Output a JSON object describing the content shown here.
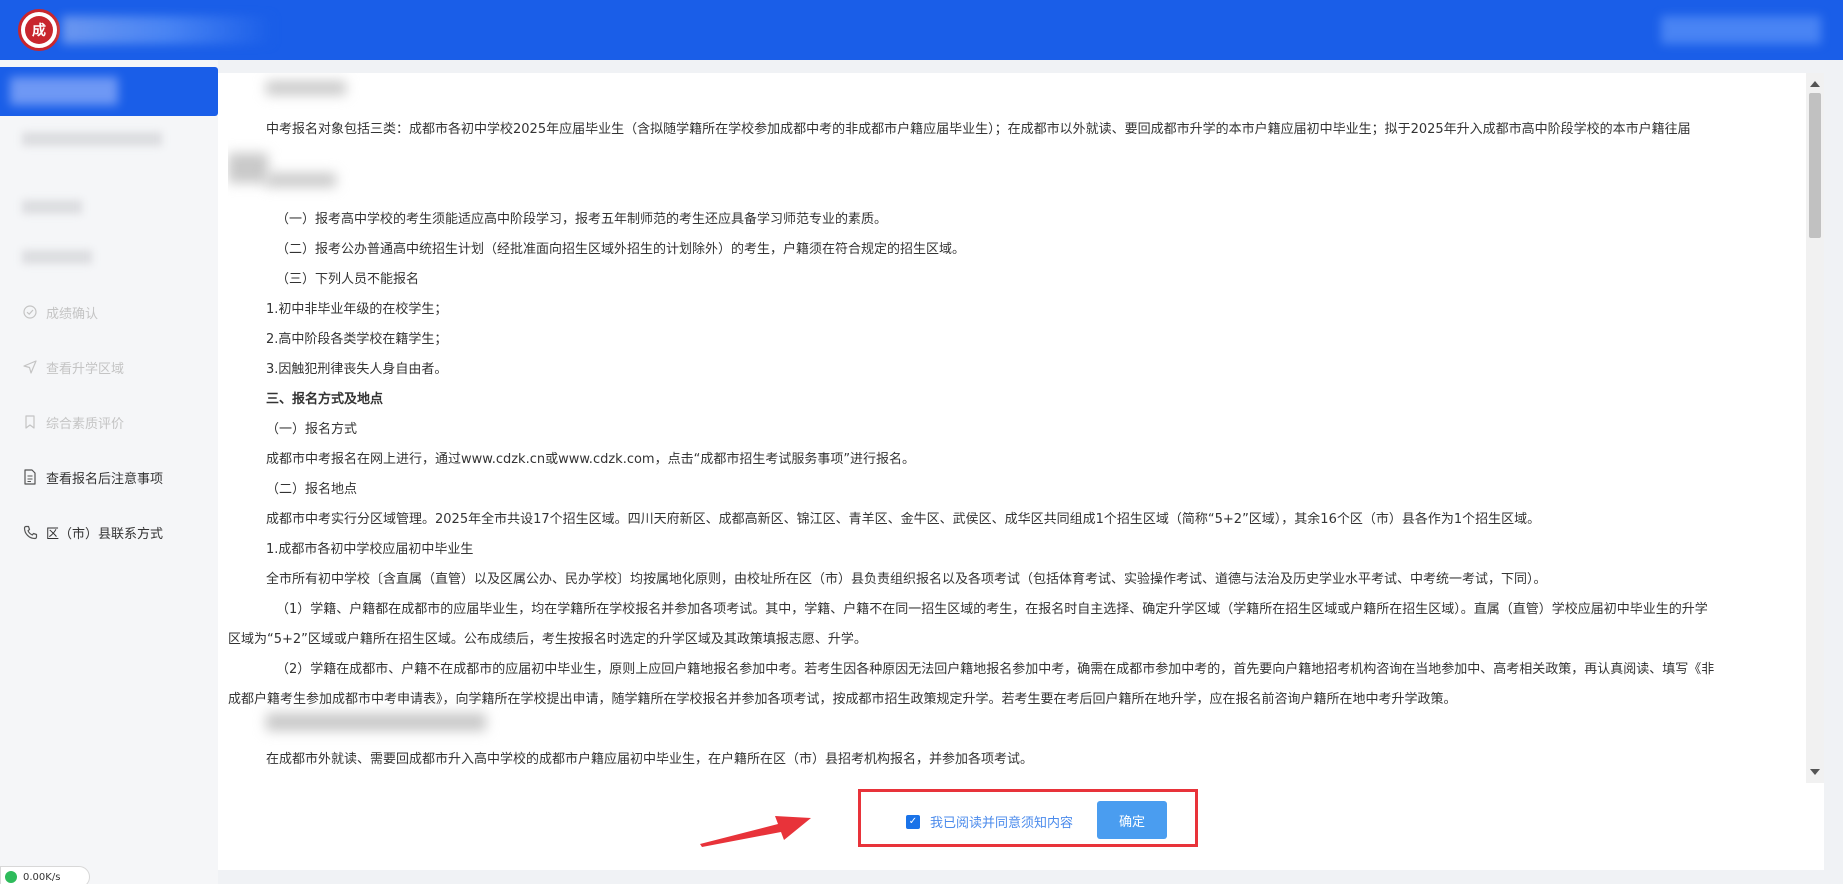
{
  "header": {
    "logo_text": "成"
  },
  "sidebar": {
    "items": [
      {
        "label": "成绩确认",
        "icon": "check-circle-icon",
        "enabled": false
      },
      {
        "label": "查看升学区域",
        "icon": "send-icon",
        "enabled": false
      },
      {
        "label": "综合素质评价",
        "icon": "bookmark-icon",
        "enabled": false
      },
      {
        "label": "查看报名后注意事项",
        "icon": "document-icon",
        "enabled": true
      },
      {
        "label": "区（市）县联系方式",
        "icon": "phone-icon",
        "enabled": true
      }
    ]
  },
  "content": {
    "p0": "中考报名对象包括三类：成都市各初中学校2025年应届毕业生（含拟随学籍所在学校参加成都中考的非成都市户籍应届毕业生）；在成都市以外就读、要回成都市升学的本市户籍应届初中毕业生；拟于2025年升入成都市高中阶段学校的本市户籍往届",
    "p1": "（一）报考高中学校的考生须能适应高中阶段学习，报考五年制师范的考生还应具备学习师范专业的素质。",
    "p2": "（二）报考公办普通高中统招生计划（经批准面向招生区域外招生的计划除外）的考生，户籍须在符合规定的招生区域。",
    "p3": "（三）下列人员不能报名",
    "p4": "1.初中非毕业年级的在校学生；",
    "p5": "2.高中阶段各类学校在籍学生；",
    "p6": "3.因触犯刑律丧失人身自由者。",
    "p7": "三、报名方式及地点",
    "p8": "（一）报名方式",
    "p9": "成都市中考报名在网上进行，通过www.cdzk.cn或www.cdzk.com，点击“成都市招生考试服务事项”进行报名。",
    "p10": "（二）报名地点",
    "p11": "成都市中考实行分区域管理。2025年全市共设17个招生区域。四川天府新区、成都高新区、锦江区、青羊区、金牛区、武侯区、成华区共同组成1个招生区域（简称“5+2”区域），其余16个区（市）县各作为1个招生区域。",
    "p12": "1.成都市各初中学校应届初中毕业生",
    "p13": "全市所有初中学校〔含直属（直管）以及区属公办、民办学校〕均按属地化原则，由校址所在区（市）县负责组织报名以及各项考试（包括体育考试、实验操作考试、道德与法治及历史学业水平考试、中考统一考试，下同）。",
    "p14": "（1）学籍、户籍都在成都市的应届毕业生，均在学籍所在学校报名并参加各项考试。其中，学籍、户籍不在同一招生区域的考生，在报名时自主选择、确定升学区域（学籍所在招生区域或户籍所在招生区域）。直属（直管）学校应届初中毕业生的升学",
    "p15": "区域为“5+2”区域或户籍所在招生区域。公布成绩后，考生按报名时选定的升学区域及其政策填报志愿、升学。",
    "p16": "（2）学籍在成都市、户籍不在成都市的应届初中毕业生，原则上应回户籍地报名参加中考。若考生因各种原因无法回户籍地报名参加中考，确需在成都市参加中考的，首先要向户籍地招考机构咨询在当地参加中、高考相关政策，再认真阅读、填写《非",
    "p17": "成都户籍考生参加成都市中考申请表》，向学籍所在学校提出申请，随学籍所在学校报名并参加各项考试，按成都市招生政策规定升学。若考生要在考后回户籍所在地升学，应在报名前咨询户籍所在地中考升学政策。",
    "p18": "在成都市外就读、需要回成都市升入高中学校的成都市户籍应届初中毕业生，在户籍所在区（市）县招考机构报名，并参加各项考试。"
  },
  "agreement": {
    "checkbox_label": "我已阅读并同意须知内容",
    "checked": true,
    "confirm_label": "确定"
  },
  "network": {
    "speed": "0.00K/s"
  },
  "colors": {
    "header_bg": "#1a5ee8",
    "highlight_border": "#e8333a",
    "button_bg": "#4a9df0"
  }
}
